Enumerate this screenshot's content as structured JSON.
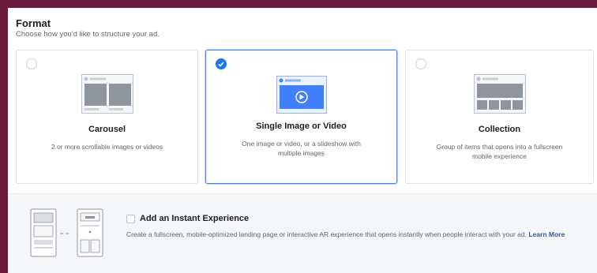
{
  "format": {
    "title": "Format",
    "subtitle": "Choose how you'd like to structure your ad."
  },
  "options": [
    {
      "name": "Carousel",
      "description": "2 or more scrollable images or videos",
      "selected": false,
      "icon": "carousel-preview-icon"
    },
    {
      "name": "Single Image or Video",
      "description": "One image or video, or a slideshow with multiple images",
      "selected": true,
      "icon": "single-image-video-preview-icon"
    },
    {
      "name": "Collection",
      "description": "Group of items that opens into a fullscreen mobile experience",
      "selected": false,
      "icon": "collection-preview-icon"
    }
  ],
  "instant_experience": {
    "label": "Add an Instant Experience",
    "description": "Create a fullscreen, mobile-optimized landing page or interactive AR experience that opens instantly when people interact with your ad.",
    "link": "Learn More",
    "checked": false,
    "icon": "instant-experience-preview-icon"
  },
  "colors": {
    "accent": "#1877f2",
    "selected_border": "#4080ff",
    "frame": "#6b1a3c"
  }
}
